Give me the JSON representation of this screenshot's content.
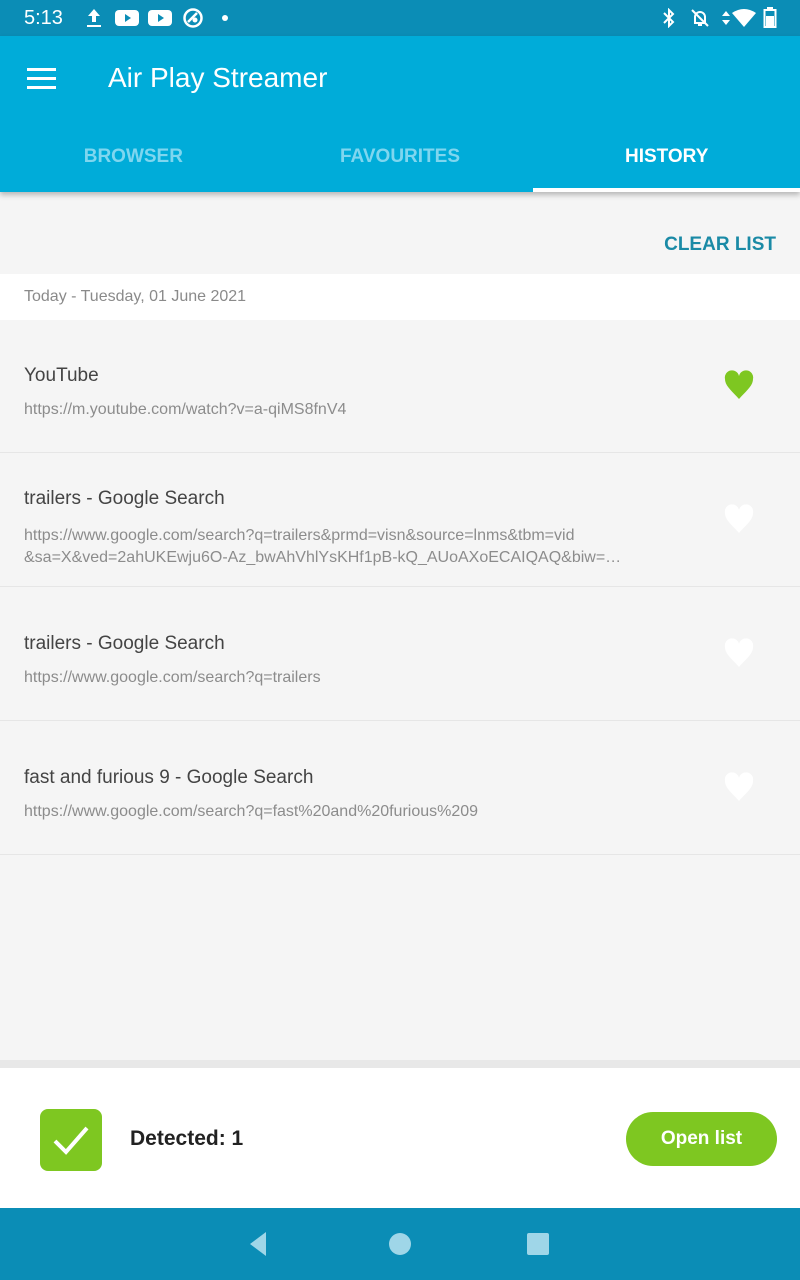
{
  "status_bar": {
    "time": "5:13",
    "left_icons": [
      "upload-icon",
      "youtube-icon",
      "youtube-icon",
      "sync-icon",
      "dot-icon"
    ],
    "right_icons": [
      "bluetooth-icon",
      "notifications-off-icon",
      "data-arrows-icon",
      "wifi-icon",
      "battery-icon"
    ]
  },
  "app_bar": {
    "title": "Air Play Streamer",
    "menu_icon": "hamburger-menu-icon"
  },
  "tabs": [
    {
      "label": "BROWSER",
      "active": false
    },
    {
      "label": "FAVOURITES",
      "active": false
    },
    {
      "label": "HISTORY",
      "active": true
    }
  ],
  "toolbar": {
    "clear_label": "CLEAR LIST"
  },
  "history": {
    "date_header": "Today - Tuesday, 01 June 2021",
    "items": [
      {
        "title": "YouTube",
        "url": "https://m.youtube.com/watch?v=a-qiMS8fnV4",
        "favourite": true
      },
      {
        "title": "trailers - Google Search",
        "url": "https://www.google.com/search?q=trailers&prmd=visn&source=lnms&tbm=vid&sa=X&ved=2ahUKEwju6O-Az_bwAhVhlYsKHf1pB-kQ_AUoAXoECAIQAQ&biw=…",
        "url_line1": "https://www.google.com/search?q=trailers&prmd=visn&source=lnms&tbm=vid",
        "url_line2": "&sa=X&ved=2ahUKEwju6O-Az_bwAhVhlYsKHf1pB-kQ_AUoAXoECAIQAQ&biw=…",
        "favourite": false
      },
      {
        "title": "trailers - Google Search",
        "url": "https://www.google.com/search?q=trailers",
        "favourite": false
      },
      {
        "title": "fast and furious 9 - Google Search",
        "url": "https://www.google.com/search?q=fast%20and%20furious%209",
        "favourite": false
      }
    ]
  },
  "bottom_panel": {
    "detected_label": "Detected: 1",
    "open_list_label": "Open list"
  },
  "nav_bar": {
    "buttons": [
      "back-icon",
      "home-icon",
      "recents-icon"
    ]
  },
  "colors": {
    "status_bar": "#0b8db6",
    "app_bar": "#00acd9",
    "accent_green": "#7ec721",
    "clear_list_text": "#1a8aa6"
  }
}
